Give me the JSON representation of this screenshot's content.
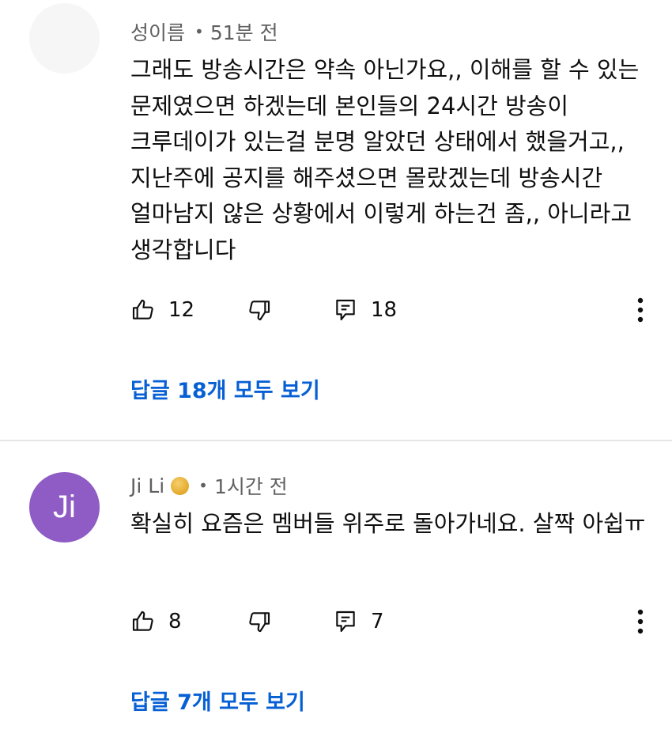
{
  "comments": [
    {
      "author": "성이름",
      "time": "51분 전",
      "text": "그래도 방송시간은 약속 아닌가요,, 이해를 할 수 있는 문제였으면 하겠는데 본인들의 24시간 방송이 크루데이가 있는걸 분명 알았던 상태에서 했을거고,, 지난주에 공지를 해주셨으면 몰랐겠는데 방송시간 얼마남지 않은 상황에서 이렇게 하는건 좀,, 아니라고 생각합니다",
      "likes": "12",
      "replies": "18",
      "view_replies": "답글 18개 모두 보기"
    },
    {
      "avatar_initials": "Ji",
      "author": "Ji Li",
      "time": "1시간 전",
      "text": "확실히 요즘은 멤버들 위주로 돌아가네요. 살짝 아쉽ㅠ",
      "likes": "8",
      "replies": "7",
      "view_replies": "답글 7개 모두 보기"
    }
  ],
  "colors": {
    "link": "#065fd4",
    "avatar_bg": "#8e5cc4",
    "meta_text": "#606060",
    "divider": "#e5e5e5"
  },
  "icons": [
    "thumb-up-icon",
    "thumb-down-icon",
    "reply-icon",
    "more-vert-icon",
    "membership-badge-icon"
  ]
}
